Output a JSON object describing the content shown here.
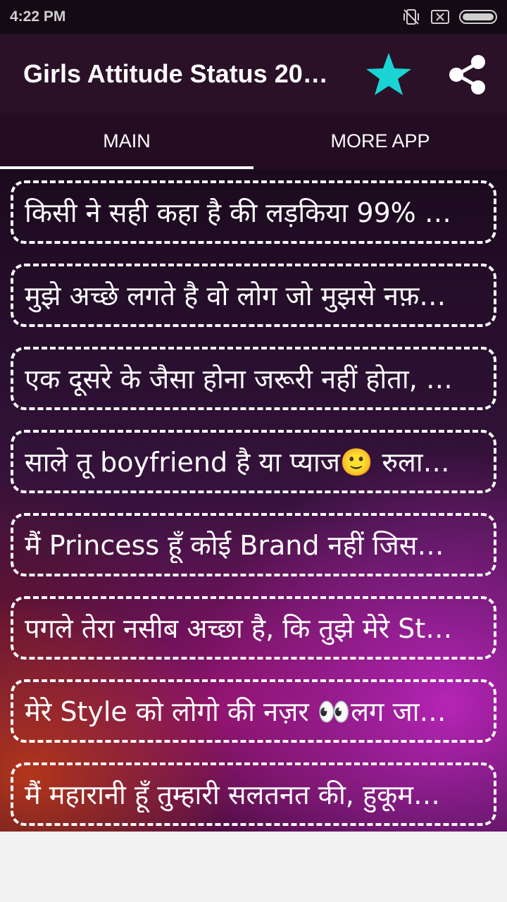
{
  "status_bar": {
    "time": "4:22 PM",
    "icons": [
      "vibrate-off-icon",
      "sim-x-icon",
      "battery-icon"
    ]
  },
  "app_bar": {
    "title": "Girls Attitude Status 20…",
    "star_icon": "star-icon",
    "share_icon": "share-icon",
    "star_color": "#1ad4d4"
  },
  "tabs": [
    {
      "label": "MAIN",
      "active": true
    },
    {
      "label": "MORE APP",
      "active": false
    }
  ],
  "statuses": [
    "किसी ने सही कहा है की लड़किया 99% …",
    "मुझे अच्छे लगते है वो लोग जो मुझसे नफ़…",
    "एक दूसरे के जैसा होना जरूरी नहीं होता, …",
    "साले तू boyfriend है या  प्याज🙂 रुला…",
    "मैं Princess हूँ कोई Brand नहीं जिस…",
    "पगले तेरा नसीब अच्छा है, कि तुझे मेरे St…",
    "मेरे Style को लोगो की नज़र 👀लग जा…",
    "मैं महारानी हूँ तुम्हारी सलतनत की, हुकूम…"
  ]
}
